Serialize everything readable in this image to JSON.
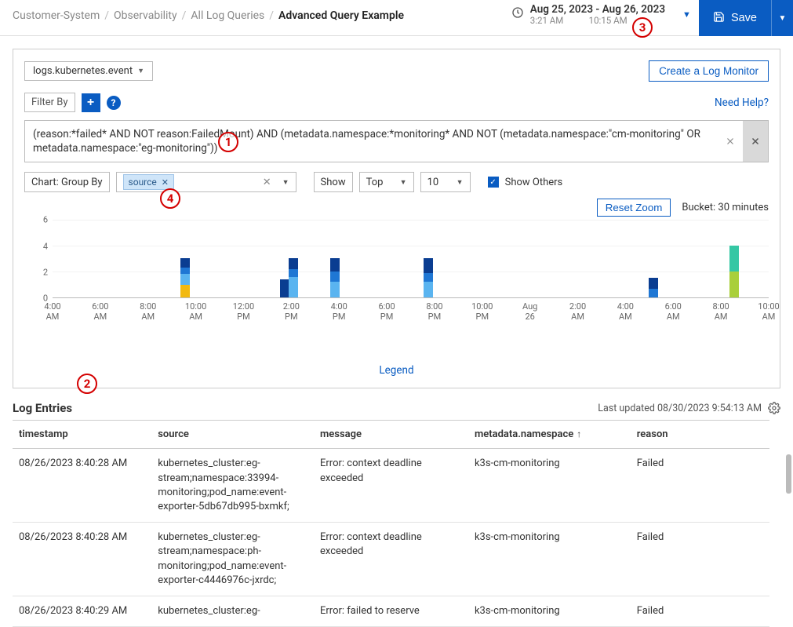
{
  "breadcrumb": {
    "a": "Customer-System",
    "b": "Observability",
    "c": "All Log Queries",
    "d": "Advanced Query Example"
  },
  "time": {
    "range": "Aug 25, 2023 - Aug 26, 2023",
    "from": "3:21 AM",
    "to": "10:15 AM"
  },
  "save_label": "Save",
  "source_select": "logs.kubernetes.event",
  "create_monitor": "Create a Log Monitor",
  "filter_by": "Filter By",
  "need_help": "Need Help?",
  "query": "(reason:*failed* AND NOT reason:FailedMount) AND (metadata.namespace:*monitoring* AND NOT (metadata.namespace:\"cm-monitoring\" OR metadata.namespace:\"eg-monitoring\"))",
  "group_by_label": "Chart: Group By",
  "group_by_tag": "source",
  "show_label": "Show",
  "show_mode": "Top",
  "show_count": "10",
  "show_others": "Show Others",
  "reset_zoom": "Reset Zoom",
  "bucket": "Bucket: 30 minutes",
  "legend": "Legend",
  "chart_data": {
    "type": "bar",
    "y_ticks": [
      0,
      2,
      4,
      6
    ],
    "ylim": [
      0,
      6
    ],
    "x_ticks": [
      "4:00 AM",
      "6:00 AM",
      "8:00 AM",
      "10:00 AM",
      "12:00 PM",
      "2:00 PM",
      "4:00 PM",
      "6:00 PM",
      "8:00 PM",
      "10:00 PM",
      "Aug 26",
      "2:00 AM",
      "4:00 AM",
      "6:00 AM",
      "8:00 AM",
      "10:00 AM"
    ],
    "colors": {
      "s1": "#0a3d91",
      "s2": "#1f77d4",
      "s3": "#5ab4f0",
      "s4": "#f2b90f",
      "s5": "#35c7a4",
      "s6": "#a9cf3b"
    },
    "bars": [
      {
        "x_pct": 17.8,
        "stack": [
          {
            "c": "s4",
            "v": 1
          },
          {
            "c": "s3",
            "v": 0.8
          },
          {
            "c": "s2",
            "v": 0.5
          },
          {
            "c": "s1",
            "v": 0.7
          }
        ]
      },
      {
        "x_pct": 31.8,
        "stack": [
          {
            "c": "s1",
            "v": 1.4
          }
        ]
      },
      {
        "x_pct": 33.0,
        "stack": [
          {
            "c": "s3",
            "v": 1.6
          },
          {
            "c": "s2",
            "v": 0.6
          },
          {
            "c": "s1",
            "v": 0.8
          }
        ]
      },
      {
        "x_pct": 38.8,
        "stack": [
          {
            "c": "s3",
            "v": 1.2
          },
          {
            "c": "s2",
            "v": 0.8
          },
          {
            "c": "s1",
            "v": 1.0
          }
        ]
      },
      {
        "x_pct": 51.8,
        "stack": [
          {
            "c": "s3",
            "v": 1.2
          },
          {
            "c": "s2",
            "v": 0.7
          },
          {
            "c": "s1",
            "v": 1.1
          }
        ]
      },
      {
        "x_pct": 83.2,
        "stack": [
          {
            "c": "s2",
            "v": 0.7
          },
          {
            "c": "s1",
            "v": 0.8
          }
        ]
      },
      {
        "x_pct": 94.5,
        "stack": [
          {
            "c": "s6",
            "v": 2.0
          },
          {
            "c": "s5",
            "v": 2.0
          }
        ]
      }
    ]
  },
  "log_entries_title": "Log Entries",
  "last_updated": "Last updated 08/30/2023 9:54:13 AM",
  "columns": {
    "ts": "timestamp",
    "src": "source",
    "msg": "message",
    "ns": "metadata.namespace",
    "rs": "reason"
  },
  "rows": [
    {
      "ts": "08/26/2023 8:40:28 AM",
      "src": "kubernetes_cluster:eg-stream;namespace:33994-monitoring;pod_name:event-exporter-5db67db995-bxmkf;",
      "msg": "Error: context deadline exceeded",
      "ns": "k3s-cm-monitoring",
      "rs": "Failed"
    },
    {
      "ts": "08/26/2023 8:40:28 AM",
      "src": "kubernetes_cluster:eg-stream;namespace:ph-monitoring;pod_name:event-exporter-c4446976c-jxrdc;",
      "msg": "Error: context deadline exceeded",
      "ns": "k3s-cm-monitoring",
      "rs": "Failed"
    },
    {
      "ts": "08/26/2023 8:40:29 AM",
      "src": "kubernetes_cluster:eg-",
      "msg": "Error: failed to reserve",
      "ns": "k3s-cm-monitoring",
      "rs": "Failed"
    }
  ],
  "callouts": {
    "1": "1",
    "2": "2",
    "3": "3",
    "4": "4"
  }
}
